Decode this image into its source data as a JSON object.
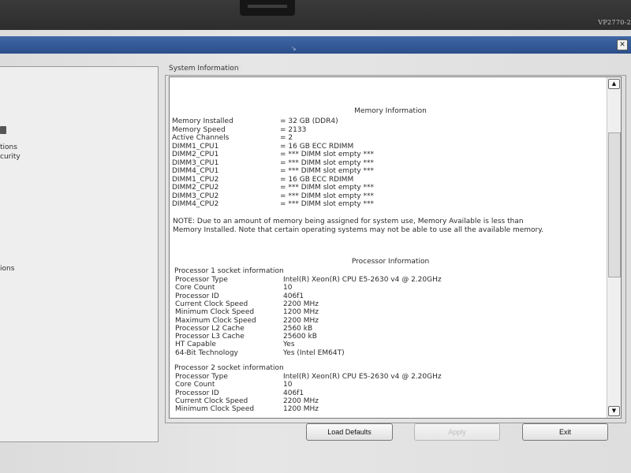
{
  "monitor": {
    "model_label": "VP2770-2"
  },
  "window": {
    "close_glyph": "✕",
    "titlebar_mark": "↘"
  },
  "left_nav": {
    "items": [
      {
        "label": "tions"
      },
      {
        "label": "curity"
      },
      {
        "label": "ions"
      }
    ]
  },
  "group": {
    "legend": "System Information"
  },
  "memory": {
    "heading": "Memory Information",
    "rows": [
      {
        "label": "Memory Installed",
        "value": "= 32 GB (DDR4)"
      },
      {
        "label": "Memory Speed",
        "value": "= 2133"
      },
      {
        "label": "Active Channels",
        "value": "= 2"
      },
      {
        "label": "DIMM1_CPU1",
        "value": "= 16 GB ECC RDIMM"
      },
      {
        "label": "DIMM2_CPU1",
        "value": "= *** DIMM slot empty ***"
      },
      {
        "label": "DIMM3_CPU1",
        "value": "= *** DIMM slot empty ***"
      },
      {
        "label": "DIMM4_CPU1",
        "value": "= *** DIMM slot empty ***"
      },
      {
        "label": "DIMM1_CPU2",
        "value": "= 16 GB ECC RDIMM"
      },
      {
        "label": "DIMM2_CPU2",
        "value": "= *** DIMM slot empty ***"
      },
      {
        "label": "DIMM3_CPU2",
        "value": "= *** DIMM slot empty ***"
      },
      {
        "label": "DIMM4_CPU2",
        "value": "= *** DIMM slot empty ***"
      }
    ],
    "note": "NOTE: Due to an amount of memory being assigned for system use, Memory Available is less than Memory Installed. Note that certain operating systems may not be able to use all the available memory."
  },
  "processor": {
    "heading": "Processor Information",
    "socket1": {
      "title": "Processor 1 socket information",
      "rows": [
        {
          "label": "Processor Type",
          "value": "Intel(R) Xeon(R) CPU E5-2630 v4 @ 2.20GHz"
        },
        {
          "label": "Core Count",
          "value": "10"
        },
        {
          "label": "Processor ID",
          "value": "406f1"
        },
        {
          "label": "Current Clock Speed",
          "value": "2200 MHz"
        },
        {
          "label": "Minimum Clock Speed",
          "value": "1200 MHz"
        },
        {
          "label": "Maximum Clock Speed",
          "value": "2200 MHz"
        },
        {
          "label": "Processor L2 Cache",
          "value": "2560 kB"
        },
        {
          "label": "Processor L3 Cache",
          "value": "25600 kB"
        },
        {
          "label": "HT Capable",
          "value": "Yes"
        },
        {
          "label": "64-Bit Technology",
          "value": "Yes (Intel EM64T)"
        }
      ]
    },
    "socket2": {
      "title": "Processor 2 socket information",
      "rows": [
        {
          "label": "Processor Type",
          "value": "Intel(R) Xeon(R) CPU E5-2630 v4 @ 2.20GHz"
        },
        {
          "label": "Core Count",
          "value": "10"
        },
        {
          "label": "Processor ID",
          "value": "406f1"
        },
        {
          "label": "Current Clock Speed",
          "value": "2200 MHz"
        },
        {
          "label": "Minimum Clock Speed",
          "value": "1200 MHz"
        }
      ]
    }
  },
  "scroll": {
    "up_glyph": "▲",
    "down_glyph": "▼"
  },
  "buttons": {
    "load_defaults": "Load Defaults",
    "apply": "Apply",
    "exit": "Exit"
  }
}
